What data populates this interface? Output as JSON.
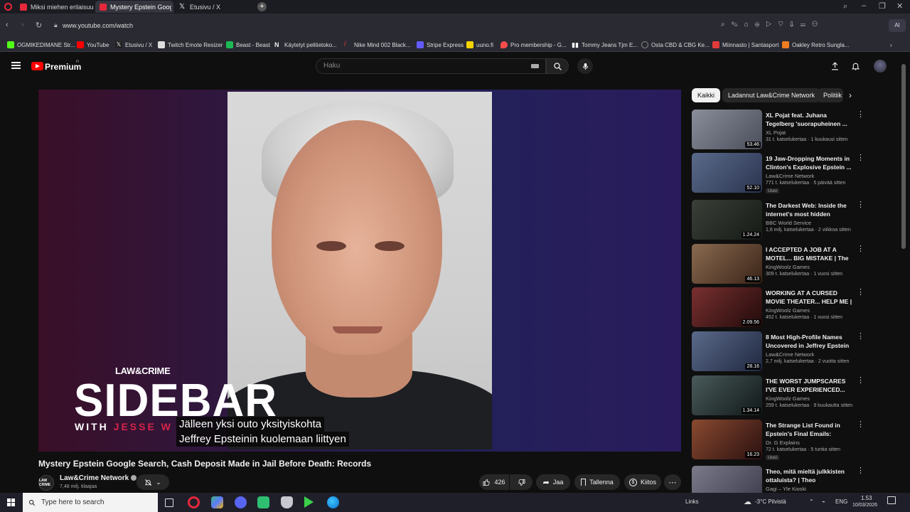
{
  "browser": {
    "tabs": [
      {
        "label": "Miksi miehen erilaisuus ko",
        "color": "#e5283b"
      },
      {
        "label": "Mystery Epstein Google S",
        "color": "#e5283b"
      },
      {
        "label": "Etusivu / X",
        "color": "#ffffff"
      }
    ],
    "url": "www.youtube.com/watch",
    "bookmarks": [
      {
        "label": "OGMIKEDIMANE Str...",
        "color": "#53fc18"
      },
      {
        "label": "YouTube",
        "color": "#ff0000"
      },
      {
        "label": "Etusivu / X",
        "color": "#ffffff"
      },
      {
        "label": "Twitch Emote Resizer",
        "color": "#9146ff"
      },
      {
        "label": "Beast - Beast",
        "color": "#1db954"
      },
      {
        "label": "Käytetyt pelitietoko...",
        "color": "#eeeeee"
      },
      {
        "label": "Nike Mind 002 Black...",
        "color": "#e23b3b"
      },
      {
        "label": "Stripe Express",
        "color": "#635bff"
      },
      {
        "label": "uuno.fi",
        "color": "#f5d400"
      },
      {
        "label": "Pro membership - G...",
        "color": "#ff4b4b"
      },
      {
        "label": "Tommy Jeans Tjm E...",
        "color": "#ffffff"
      },
      {
        "label": "Osta CBD & CBG Ke...",
        "color": "#8a8a8a"
      },
      {
        "label": "Miinnasto | Santasport",
        "color": "#e23b3b"
      },
      {
        "label": "Oakley Retro Sungla...",
        "color": "#f27c22"
      }
    ]
  },
  "youtube": {
    "brand": "Premium",
    "brand_sup": "FI",
    "search_placeholder": "Haku"
  },
  "video": {
    "overlay_logo_top": "LAW&CRIME",
    "overlay_logo_main": "SIDEBAR",
    "overlay_logo_with": "WITH",
    "overlay_logo_name": "JESSE W",
    "subtitle_line1": "Jälleen yksi outo yksityiskohta",
    "subtitle_line2": "Jeffrey Epsteinin kuolemaan liittyen",
    "title": "Mystery Epstein Google Search, Cash Deposit Made in Jail Before Death: Records",
    "channel": "Law&Crime Network",
    "channel_avatar_text": "LAW CRIME",
    "subscribers": "7,48 milj. tilaajaa",
    "likes": "426",
    "share": "Jaa",
    "save": "Tallenna",
    "thanks": "Kiitos"
  },
  "chips": [
    "Kaikki",
    "Ladannut Law&Crime Network",
    "Politiik"
  ],
  "recommended": [
    {
      "title": "XL Pojat feat. Juhana Tegelberg 'suorapuheinen ...",
      "channel": "XL Pojat",
      "meta": "31 t. katselukertaa · 1 kuukausi sitten",
      "duration": "53.46",
      "badge": "",
      "color": "#6a6e7a"
    },
    {
      "title": "19 Jaw-Dropping Moments in Clinton's Explosive Epstein ...",
      "channel": "Law&Crime Network",
      "meta": "771 t. katselukertaa · 5 päivää sitten",
      "duration": "52.10",
      "badge": "Uusi",
      "color": "#3a4a6a"
    },
    {
      "title": "The Darkest Web: Inside the internet's most hidden corner...",
      "channel": "BBC World Service",
      "meta": "1,6 milj. katselukertaa · 2 viikkoa sitten",
      "duration": "1.24.24",
      "badge": "",
      "color": "#2a3028"
    },
    {
      "title": "I ACCEPTED A JOB AT A MOTEL... BIG MISTAKE | The ...",
      "channel": "KingWoolz Games",
      "meta": "309 t. katselukertaa · 1 vuosi sitten",
      "duration": "46.13",
      "badge": "",
      "color": "#5a4030"
    },
    {
      "title": "WORKING AT A CURSED MOVIE THEATER... HELP ME | ...",
      "channel": "KingWoolz Games",
      "meta": "452 t. katselukertaa · 1 vuosi sitten",
      "duration": "2.09.56",
      "badge": "",
      "color": "#4a2020"
    },
    {
      "title": "8 Most High-Profile Names Uncovered in Jeffrey Epstein ...",
      "channel": "Law&Crime Network",
      "meta": "2,7 milj. katselukertaa · 2 vuotta sitten",
      "duration": "28.16",
      "badge": "",
      "color": "#3a4a6a"
    },
    {
      "title": "THE WORST JUMPSCARES I'VE EVER EXPERIENCED...",
      "channel": "KingWoolz Games",
      "meta": "259 t. katselukertaa · 9 kuukautta sitten",
      "duration": "1.34.14",
      "badge": "",
      "color": "#2a3a3a"
    },
    {
      "title": "The Strange List Found in Epstein's Final Emails: Forensi...",
      "channel": "Dr. G Explains",
      "meta": "72 t. katselukertaa · 5 tuntia sitten",
      "duration": "16.23",
      "badge": "Uusi",
      "color": "#6a3a2a"
    },
    {
      "title": "Theo, mitä mieltä julkkisten ottaluista? | Theo Kolehmaine...",
      "channel": "Gagi – Yle Kioski",
      "meta": "",
      "duration": "",
      "badge": "",
      "color": "#5a5a6a"
    }
  ],
  "taskbar": {
    "search_placeholder": "Type here to search",
    "links": "Links",
    "weather": "-3°C  Pilvistä",
    "lang": "ENG",
    "time": "1.53",
    "date": "10/03/2026"
  }
}
